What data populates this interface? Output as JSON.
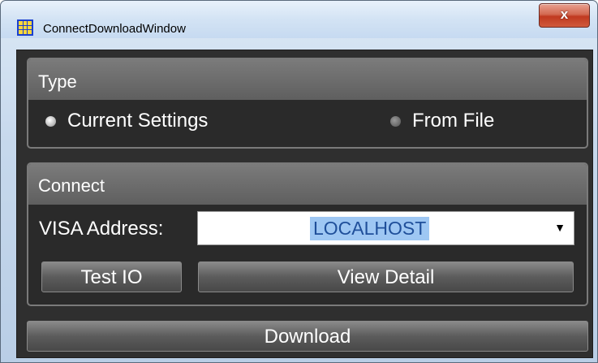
{
  "window": {
    "title": "ConnectDownloadWindow",
    "close_glyph": "x",
    "app_icon": "grid-icon"
  },
  "type_group": {
    "header": "Type",
    "options": [
      {
        "label": "Current Settings",
        "checked": true
      },
      {
        "label": "From File",
        "checked": false
      }
    ]
  },
  "connect_group": {
    "header": "Connect",
    "visa_label": "VISA Address:",
    "visa_value": "LOCALHOST",
    "dropdown_icon": "chevron-down-icon",
    "test_io_label": "Test IO",
    "view_detail_label": "View Detail"
  },
  "download_label": "Download",
  "colors": {
    "panel_background": "#2f2f2f",
    "header_gradient_top": "#7b7b7b",
    "selection_highlight": "#9ec7f3",
    "close_button": "#c0391f"
  }
}
